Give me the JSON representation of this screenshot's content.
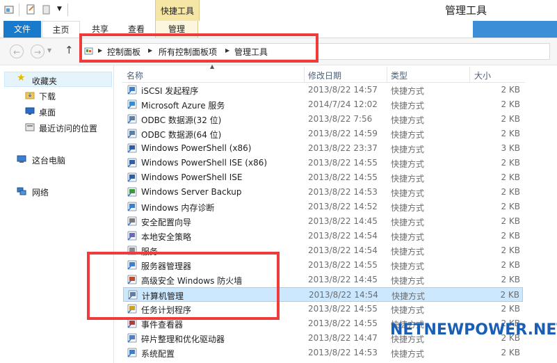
{
  "titlebar": {
    "tool_tab": "快捷工具",
    "title": "管理工具"
  },
  "ribbon": {
    "tabs": [
      "文件",
      "主页",
      "共享",
      "查看",
      "管理"
    ]
  },
  "address": {
    "crumbs": [
      "控制面板",
      "所有控制面板项",
      "管理工具"
    ]
  },
  "navpane": {
    "favorites": "收藏夹",
    "fav_items": [
      "下载",
      "桌面",
      "最近访问的位置"
    ],
    "this_pc": "这台电脑",
    "network": "网络"
  },
  "columns": {
    "name": "名称",
    "date": "修改日期",
    "type": "类型",
    "size": "大小"
  },
  "files": [
    {
      "name": "iSCSI 发起程序",
      "date": "2013/8/22 14:57",
      "type": "快捷方式",
      "size": "2 KB",
      "icon": "iscsi-icon"
    },
    {
      "name": "Microsoft Azure 服务",
      "date": "2014/7/24 12:02",
      "type": "快捷方式",
      "size": "2 KB",
      "icon": "azure-icon"
    },
    {
      "name": "ODBC 数据源(32 位)",
      "date": "2013/8/22 7:56",
      "type": "快捷方式",
      "size": "2 KB",
      "icon": "odbc-icon"
    },
    {
      "name": "ODBC 数据源(64 位)",
      "date": "2013/8/22 14:59",
      "type": "快捷方式",
      "size": "2 KB",
      "icon": "odbc-icon"
    },
    {
      "name": "Windows PowerShell (x86)",
      "date": "2013/8/22 23:37",
      "type": "快捷方式",
      "size": "3 KB",
      "icon": "powershell-icon"
    },
    {
      "name": "Windows PowerShell ISE (x86)",
      "date": "2013/8/22 14:55",
      "type": "快捷方式",
      "size": "2 KB",
      "icon": "powershell-ise-icon"
    },
    {
      "name": "Windows PowerShell ISE",
      "date": "2013/8/22 14:55",
      "type": "快捷方式",
      "size": "2 KB",
      "icon": "powershell-ise-icon"
    },
    {
      "name": "Windows Server Backup",
      "date": "2013/8/22 14:53",
      "type": "快捷方式",
      "size": "2 KB",
      "icon": "backup-icon"
    },
    {
      "name": "Windows 内存诊断",
      "date": "2013/8/22 14:52",
      "type": "快捷方式",
      "size": "2 KB",
      "icon": "memory-diagnostic-icon"
    },
    {
      "name": "安全配置向导",
      "date": "2013/8/22 14:45",
      "type": "快捷方式",
      "size": "2 KB",
      "icon": "security-wizard-icon"
    },
    {
      "name": "本地安全策略",
      "date": "2013/8/22 14:54",
      "type": "快捷方式",
      "size": "2 KB",
      "icon": "security-policy-icon"
    },
    {
      "name": "服务",
      "date": "2013/8/22 14:54",
      "type": "快捷方式",
      "size": "2 KB",
      "icon": "services-icon"
    },
    {
      "name": "服务器管理器",
      "date": "2013/8/22 14:55",
      "type": "快捷方式",
      "size": "2 KB",
      "icon": "server-manager-icon"
    },
    {
      "name": "高级安全 Windows 防火墙",
      "date": "2013/8/22 14:45",
      "type": "快捷方式",
      "size": "2 KB",
      "icon": "firewall-icon"
    },
    {
      "name": "计算机管理",
      "date": "2013/8/22 14:54",
      "type": "快捷方式",
      "size": "2 KB",
      "icon": "computer-management-icon"
    },
    {
      "name": "任务计划程序",
      "date": "2013/8/22 14:55",
      "type": "快捷方式",
      "size": "2 KB",
      "icon": "task-scheduler-icon"
    },
    {
      "name": "事件查看器",
      "date": "2013/8/22 14:55",
      "type": "快捷方式",
      "size": "2 KB",
      "icon": "event-viewer-icon"
    },
    {
      "name": "碎片整理和优化驱动器",
      "date": "2013/8/22 14:47",
      "type": "快捷方式",
      "size": "2 KB",
      "icon": "defrag-icon"
    },
    {
      "name": "系统配置",
      "date": "2013/8/22 14:53",
      "type": "快捷方式",
      "size": "2 KB",
      "icon": "system-config-icon"
    }
  ],
  "watermark": "NETNEWPOWER.NET",
  "colors": {
    "accent": "#1979ca",
    "highlight": "#ef3b3b",
    "selection": "#cce8ff"
  }
}
